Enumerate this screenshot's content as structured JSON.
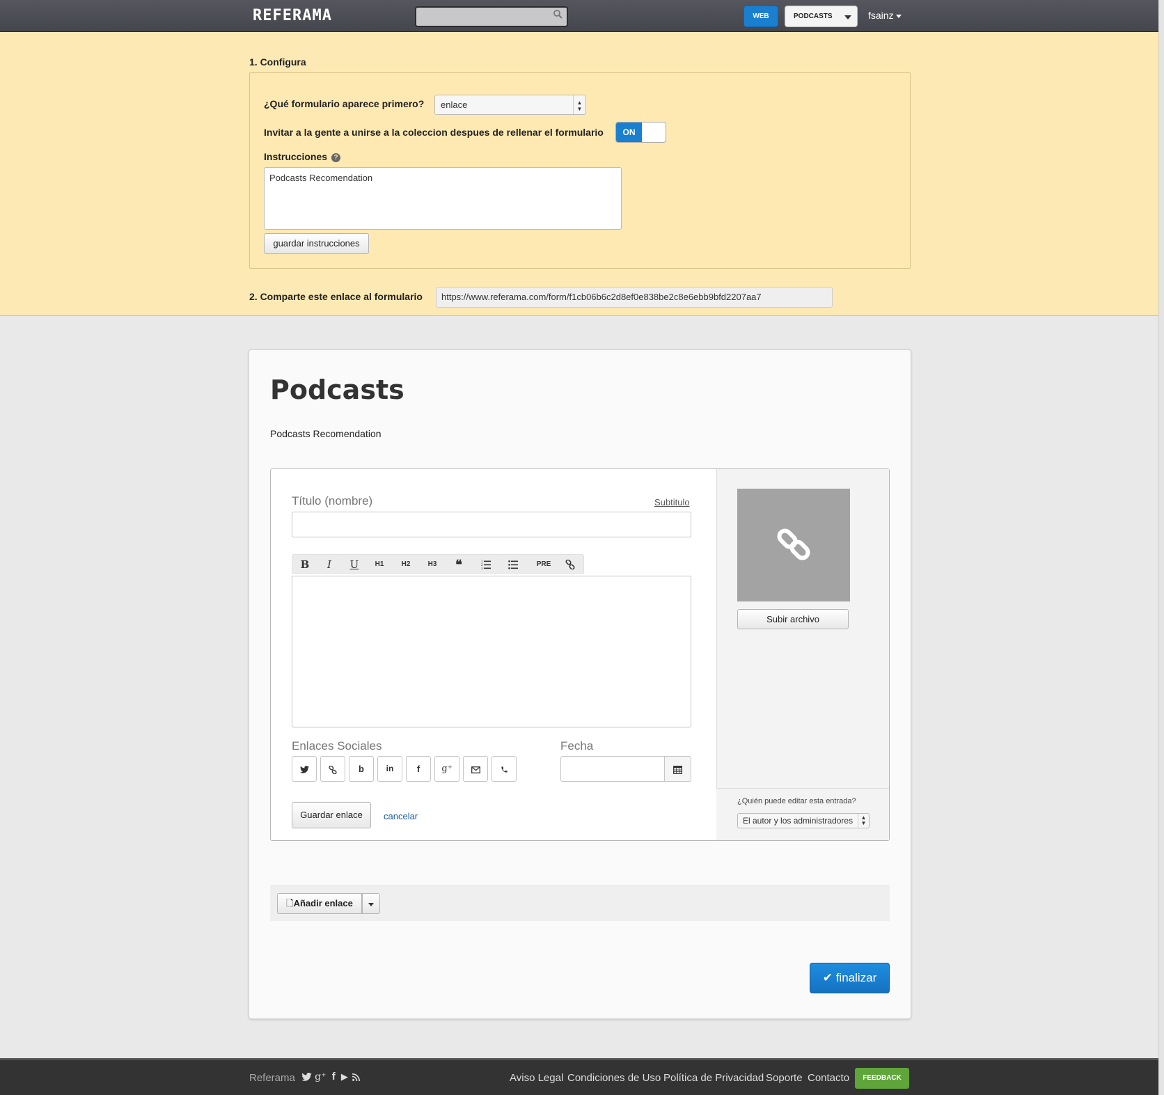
{
  "header": {
    "logo": "REFERAMA",
    "search_placeholder": "",
    "web_button": "WEB",
    "collection_button": "PODCASTS",
    "user": "fsainz"
  },
  "config": {
    "section1_title": "1. Configura",
    "first_form_label": "¿Qué formulario aparece primero?",
    "first_form_value": "enlace",
    "invite_label": "Invitar a la gente a unirse a la coleccion despues de rellenar el formulario",
    "invite_toggle": "ON",
    "instructions_label": "Instrucciones",
    "instructions_value": "Podcasts Recomendation",
    "save_instructions_button": "guardar instrucciones",
    "section2_title": "2. Comparte este enlace al formulario",
    "share_url": "https://www.referama.com/form/f1cb06b6c2d8ef0e838be2c8e6ebb9bfd2207aa7"
  },
  "form": {
    "title": "Podcasts",
    "description": "Podcasts Recomendation",
    "title_field_label": "Título (nombre)",
    "subtitle_link": "Subtitulo",
    "toolbar": [
      "B",
      "I",
      "U",
      "H1",
      "H2",
      "H3",
      "❝",
      "ol",
      "ul",
      "PRE",
      "link"
    ],
    "social_label": "Enlaces Sociales",
    "social_icons": [
      "twitter-icon",
      "link-icon",
      "blogger-icon",
      "linkedin-icon",
      "facebook-icon",
      "google-plus-icon",
      "email-icon",
      "phone-icon"
    ],
    "social_glyphs": {
      "blogger": "b",
      "linkedin": "in",
      "facebook": "f",
      "google_plus": "g⁺"
    },
    "date_label": "Fecha",
    "upload_button": "Subir archivo",
    "who_can_edit_label": "¿Quién puede editar esta entrada?",
    "who_can_edit_value": "El autor y los administradores",
    "save_link_button": "Guardar enlace",
    "cancel_link": "cancelar",
    "add_link_button": "Añadir enlace",
    "finish_button": "finalizar"
  },
  "footer": {
    "brand": "Referama",
    "links": [
      "Aviso Legal",
      "Condiciones de Uso",
      "Política de Privacidad",
      "Soporte",
      "Contacto"
    ],
    "feedback_button": "FEEDBACK"
  },
  "colors": {
    "accent": "#1b7fd0",
    "config_background": "#fde9b4",
    "feedback": "#5fa53a"
  }
}
